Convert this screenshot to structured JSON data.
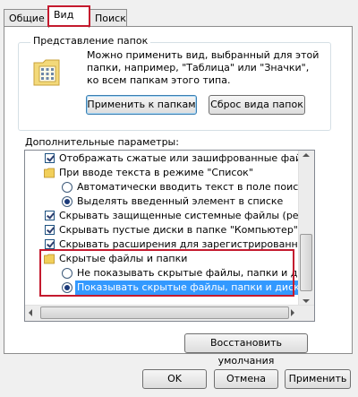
{
  "tabs": [
    {
      "label": "Общие",
      "active": false
    },
    {
      "label": "Вид",
      "active": true
    },
    {
      "label": "Поиск",
      "active": false
    }
  ],
  "folder_views": {
    "legend": "Представление папок",
    "description": "Можно применить вид, выбранный для этой папки, например, \"Таблица\" или \"Значки\", ко всем папкам этого типа.",
    "apply_button": "Применить к папкам",
    "reset_button": "Сброс вида папок",
    "icon": "folder-grid-icon"
  },
  "advanced": {
    "label": "Дополнительные параметры:",
    "items": [
      {
        "type": "checkbox",
        "checked": true,
        "indent": 1,
        "label": "Отображать сжатые или зашифрованные файлы NTFS"
      },
      {
        "type": "folder",
        "indent": 1,
        "label": "При вводе текста в режиме \"Список\""
      },
      {
        "type": "radio",
        "checked": false,
        "indent": 2,
        "label": "Автоматически вводить текст в поле поиска"
      },
      {
        "type": "radio",
        "checked": true,
        "indent": 2,
        "label": "Выделять введенный элемент в списке"
      },
      {
        "type": "checkbox",
        "checked": true,
        "indent": 1,
        "label": "Скрывать защищенные системные файлы (рекомендуется)"
      },
      {
        "type": "checkbox",
        "checked": true,
        "indent": 1,
        "label": "Скрывать пустые диски в папке \"Компьютер\""
      },
      {
        "type": "checkbox",
        "checked": true,
        "indent": 1,
        "label": "Скрывать расширения для зарегистрированных типов файлов"
      },
      {
        "type": "folder",
        "indent": 1,
        "label": "Скрытые файлы и папки"
      },
      {
        "type": "radio",
        "checked": false,
        "indent": 2,
        "label": "Не показывать скрытые файлы, папки и диски"
      },
      {
        "type": "radio",
        "checked": true,
        "indent": 2,
        "label": "Показывать скрытые файлы, папки и диски",
        "selected": true
      }
    ]
  },
  "restore_button": "Восстановить умолчания",
  "footer": {
    "ok": "OK",
    "cancel": "Отмена",
    "apply": "Применить"
  },
  "colors": {
    "highlight_red": "#c41a2e",
    "selection_blue": "#3399ff"
  }
}
